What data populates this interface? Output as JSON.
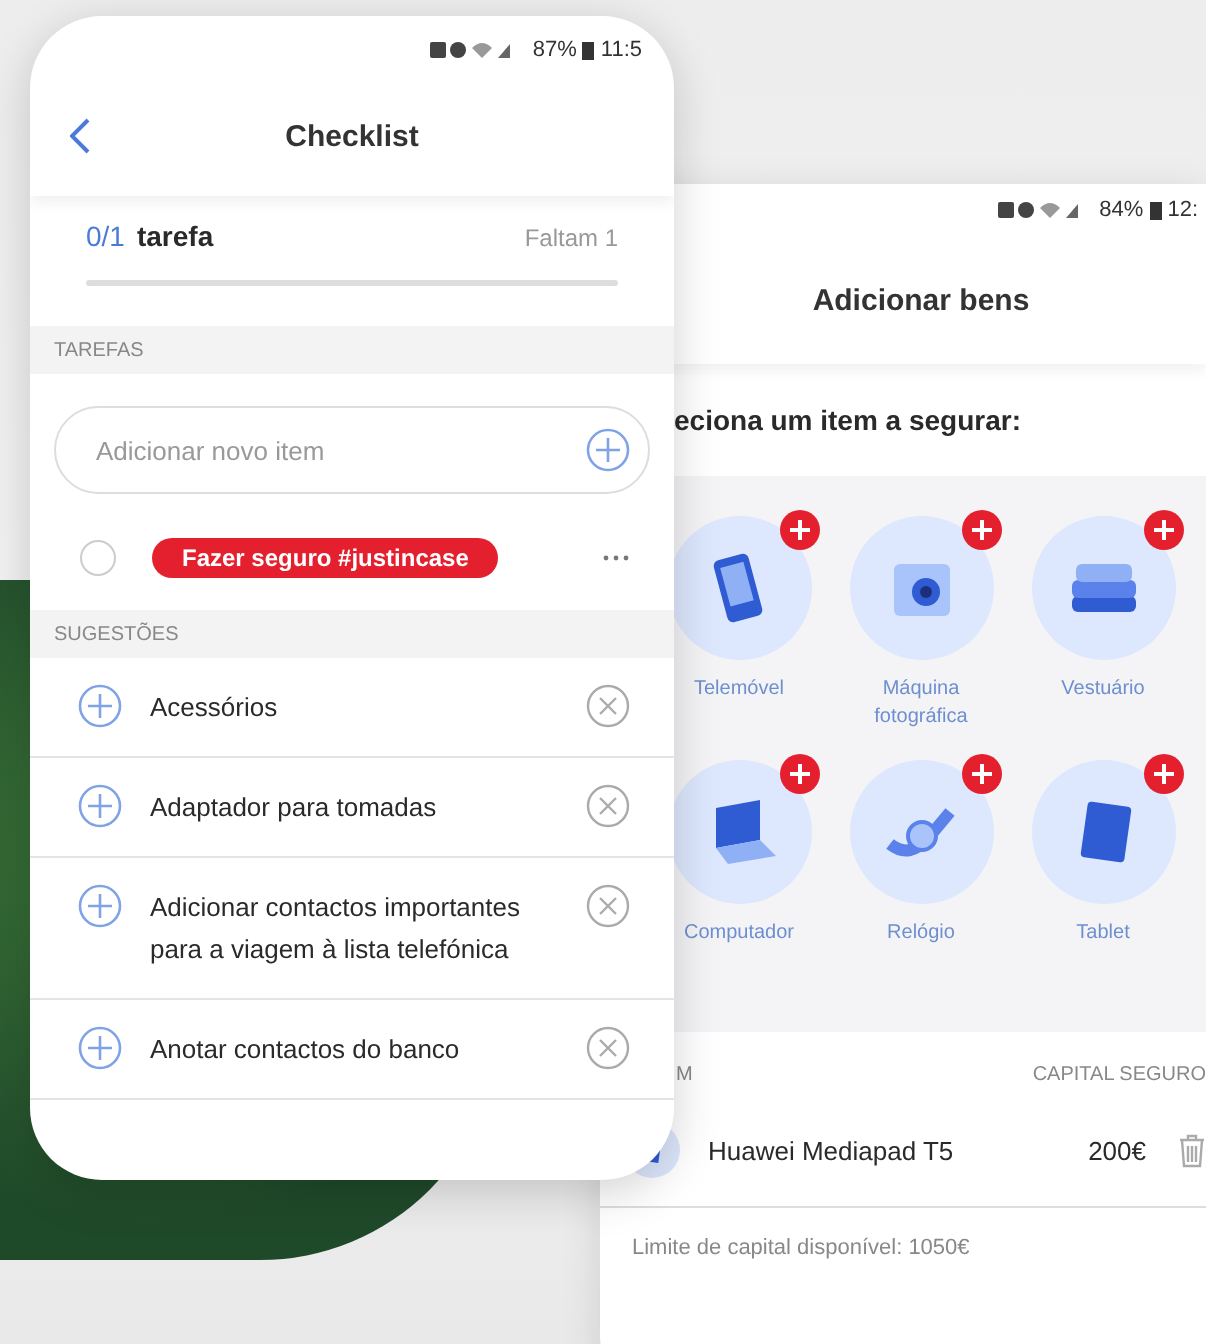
{
  "checklist_screen": {
    "status_bar": {
      "battery": "87%",
      "time": "11:5"
    },
    "title": "Checklist",
    "progress": {
      "count": "0/1",
      "label": "tarefa",
      "remaining": "Faltam 1",
      "level": 0
    },
    "tasks_header": "TAREFAS",
    "new_item": {
      "placeholder": "Adicionar novo item"
    },
    "tasks": [
      {
        "label": "Fazer seguro #justincase",
        "checked": false
      }
    ],
    "suggestions_header": "SUGESTÕES",
    "suggestions": [
      {
        "label": "Acessórios"
      },
      {
        "label": "Adaptador para tomadas"
      },
      {
        "label": "Adicionar contactos importantes para a viagem à lista telefónica"
      },
      {
        "label": "Anotar contactos do banco"
      }
    ]
  },
  "goods_screen": {
    "status_bar": {
      "battery": "84%",
      "time": "12:"
    },
    "title": "Adicionar bens",
    "prompt": "eciona um item a segurar:",
    "categories": [
      {
        "label": "Telemóvel"
      },
      {
        "label": "Máquina fotográfica"
      },
      {
        "label": "Vestuário"
      },
      {
        "label": "Computador"
      },
      {
        "label": "Relógio"
      },
      {
        "label": "Tablet"
      }
    ],
    "table": {
      "column_1": "M",
      "column_2": "CAPITAL SEGURO",
      "rows": [
        {
          "name": "Huawei Mediapad T5",
          "capital": "200€"
        }
      ]
    },
    "limit_note": "Limite de capital disponível: 1050€"
  }
}
